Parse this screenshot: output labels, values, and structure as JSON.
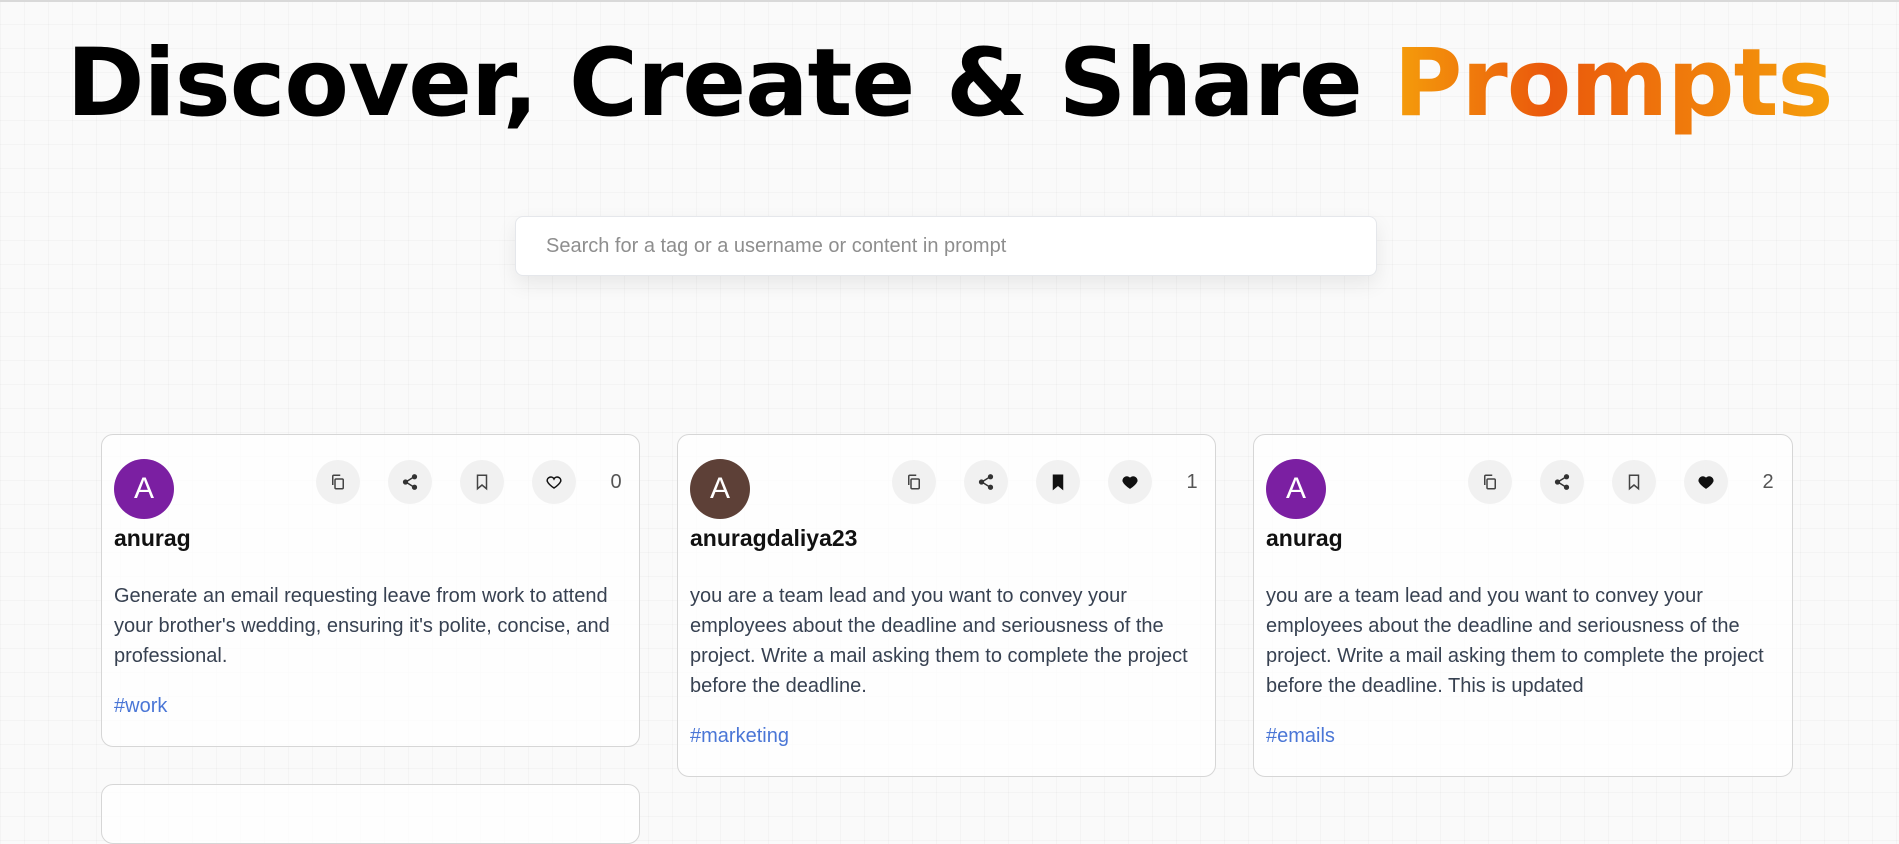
{
  "hero": {
    "title_prefix": "Discover, Create & Share ",
    "title_accent": "Prompts"
  },
  "search": {
    "placeholder": "Search for a tag or a username or content in prompt",
    "value": ""
  },
  "cards": [
    {
      "avatar_letter": "A",
      "avatar_color": "#7b1fa2",
      "username": "anurag",
      "like_count": "0",
      "bookmarked": false,
      "liked": false,
      "text": "Generate an email requesting leave from work to attend your brother's wedding, ensuring it's polite, concise, and professional.",
      "tag": "#work"
    },
    {
      "avatar_letter": "A",
      "avatar_color": "#5d4037",
      "username": "anuragdaliya23",
      "like_count": "1",
      "bookmarked": true,
      "liked": true,
      "text": "you are a team lead and you want to convey your employees about the deadline and seriousness of the project. Write a mail asking them to complete the project before the deadline.",
      "tag": "#marketing"
    },
    {
      "avatar_letter": "A",
      "avatar_color": "#7b1fa2",
      "username": "anurag",
      "like_count": "2",
      "bookmarked": false,
      "liked": true,
      "text": "you are a team lead and you want to convey your employees about the deadline and seriousness of the project. Write a mail asking them to complete the project before the deadline. This is updated",
      "tag": "#emails"
    }
  ],
  "icons": [
    "copy-icon",
    "share-icon",
    "bookmark-icon",
    "heart-icon"
  ]
}
